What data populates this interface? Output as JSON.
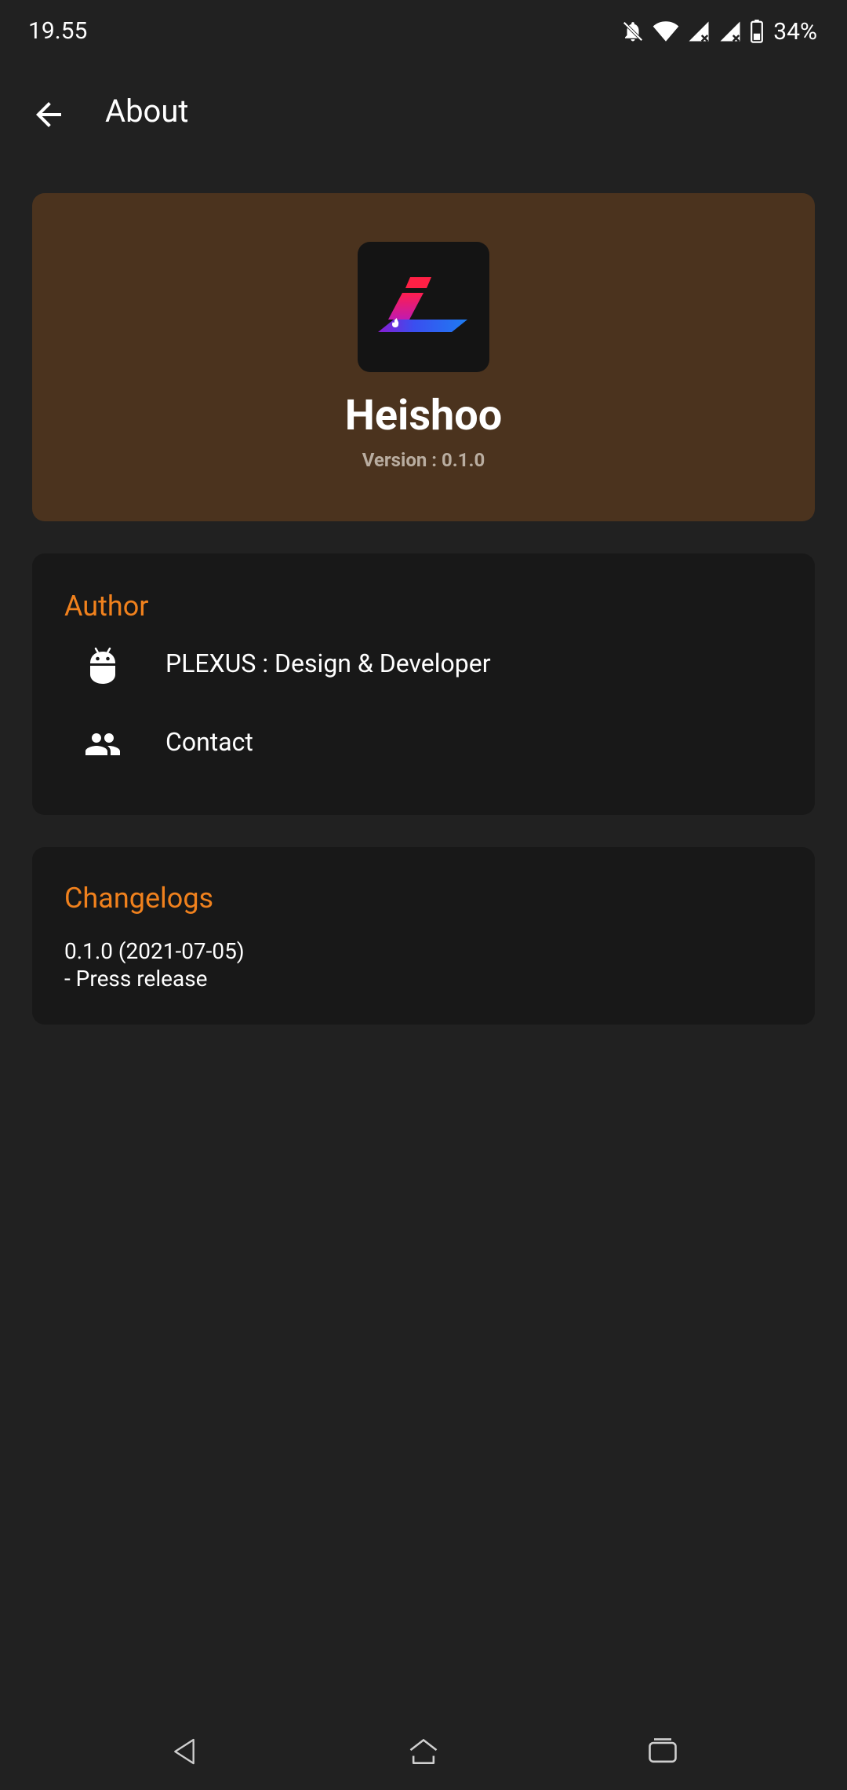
{
  "status_bar": {
    "time": "19.55",
    "battery_percent": "34%",
    "icons": [
      "mute-notifications-icon",
      "wifi-icon",
      "signal-icon",
      "signal-icon",
      "battery-icon"
    ]
  },
  "app_bar": {
    "title": "About",
    "back_icon": "arrow-back-icon"
  },
  "hero": {
    "app_name": "Heishoo",
    "version": "Version : 0.1.0",
    "icon": "app-logo-icon"
  },
  "author": {
    "title": "Author",
    "items": [
      {
        "label": "PLEXUS : Design & Developer",
        "icon": "android-icon"
      },
      {
        "label": "Contact",
        "icon": "people-icon"
      }
    ]
  },
  "changelog": {
    "title": "Changelogs",
    "entries": [
      {
        "line1": "0.1.0 (2021-07-05)",
        "line2": "- Press release"
      }
    ]
  },
  "nav_bar": {
    "icons": [
      "nav-back-icon",
      "nav-home-icon",
      "nav-recents-icon"
    ]
  },
  "colors": {
    "background": "#212121",
    "hero_card": "#4b331e",
    "card": "#181818",
    "accent": "#f0811d"
  }
}
